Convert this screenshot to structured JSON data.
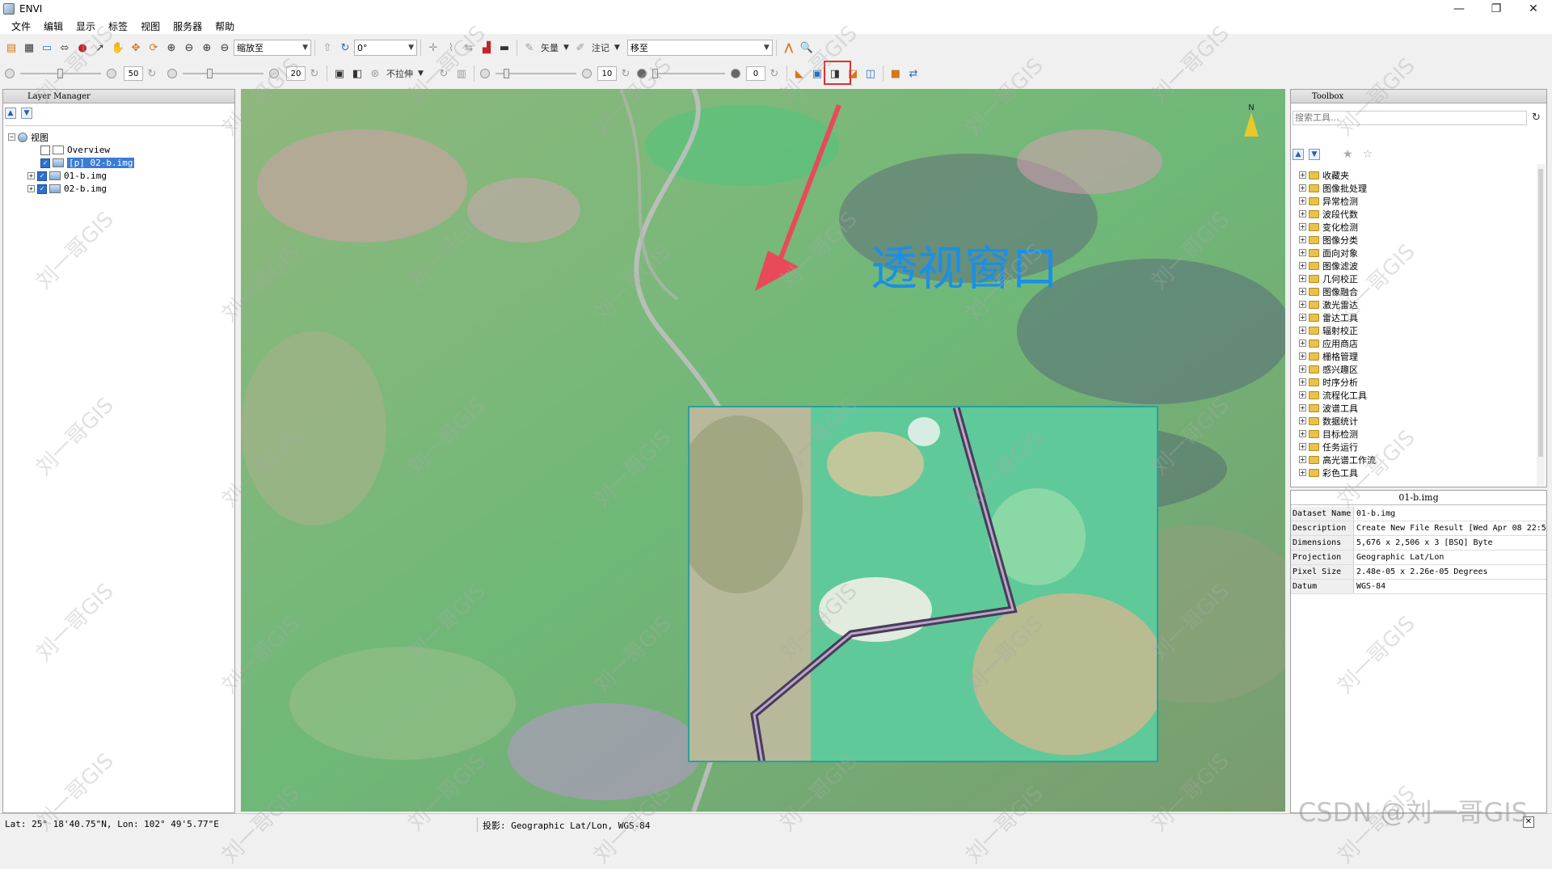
{
  "window": {
    "title": "ENVI",
    "controls": [
      "—",
      "❐",
      "✕"
    ]
  },
  "menu": [
    "文件",
    "编辑",
    "显示",
    "标签",
    "视图",
    "服务器",
    "帮助"
  ],
  "toolbar1": {
    "zoom_combo": "缩放至",
    "rotation_combo": "0°",
    "vector_label": "矢量",
    "annotation_label": "注记",
    "goto_value": "移至"
  },
  "toolbar2": {
    "brightness_value": "50",
    "contrast_value": "20",
    "stretch_label": "不拉伸",
    "sharpen_value": "10",
    "transparency_value": "0"
  },
  "layer_manager": {
    "header": "Layer Manager",
    "root": "视图",
    "items": [
      {
        "label": "Overview",
        "checked": false
      },
      {
        "label": "[p] 02-b.img",
        "checked": true,
        "selected": true
      },
      {
        "label": "01-b.img",
        "checked": true
      },
      {
        "label": "02-b.img",
        "checked": true
      }
    ]
  },
  "map": {
    "portal_label": "透视窗口",
    "north_label": "N"
  },
  "toolbox": {
    "header": "Toolbox",
    "search_placeholder": "搜索工具...",
    "folders": [
      "收藏夹",
      "图像批处理",
      "异常检测",
      "波段代数",
      "变化检测",
      "图像分类",
      "面向对象",
      "图像滤波",
      "几何校正",
      "图像融合",
      "激光雷达",
      "雷达工具",
      "辐射校正",
      "应用商店",
      "栅格管理",
      "感兴趣区",
      "时序分析",
      "流程化工具",
      "波谱工具",
      "数据统计",
      "目标检测",
      "任务运行",
      "高光谱工作流",
      "彩色工具"
    ]
  },
  "metadata": {
    "title": "01-b.img",
    "rows": [
      {
        "key": "Dataset Name",
        "value": "01-b.img"
      },
      {
        "key": "Description",
        "value": "Create New File Result [Wed Apr 08 22:5"
      },
      {
        "key": "Dimensions",
        "value": "5,676 x 2,506 x 3 [BSQ] Byte"
      },
      {
        "key": "Projection",
        "value": "Geographic Lat/Lon"
      },
      {
        "key": "Pixel Size",
        "value": "2.48e-05 x 2.26e-05 Degrees"
      },
      {
        "key": "Datum",
        "value": "WGS-84"
      }
    ]
  },
  "status": {
    "latlon": "Lat: 25° 18'40.75\"N, Lon: 102° 49'5.77\"E",
    "projection": "投影:  Geographic Lat/Lon, WGS-84"
  },
  "watermark": {
    "text": "刘一哥GIS",
    "csdn": "CSDN @刘一哥GIS"
  },
  "colors": {
    "accent_red": "#e03030",
    "portal_border": "#2aa0a0",
    "label_blue": "#1a8fe8"
  }
}
